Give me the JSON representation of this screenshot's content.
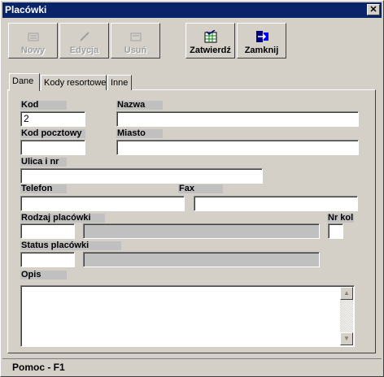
{
  "window": {
    "title": "Placówki",
    "close_glyph": "✕"
  },
  "toolbar": {
    "new_label": "Nowy",
    "edit_label": "Edycja",
    "delete_label": "Usuń",
    "confirm_label": "Zatwierdź",
    "close_label": "Zamknij"
  },
  "tabs": [
    {
      "label": "Dane"
    },
    {
      "label": "Kody resortowe"
    },
    {
      "label": "Inne"
    }
  ],
  "form": {
    "kod": {
      "label": "Kod",
      "value": "2"
    },
    "nazwa": {
      "label": "Nazwa",
      "value": ""
    },
    "kod_pocztowy": {
      "label": "Kod pocztowy",
      "value": ""
    },
    "miasto": {
      "label": "Miasto",
      "value": ""
    },
    "ulica": {
      "label": "Ulica i nr",
      "value": ""
    },
    "telefon": {
      "label": "Telefon",
      "value": ""
    },
    "fax": {
      "label": "Fax",
      "value": ""
    },
    "rodzaj": {
      "label": "Rodzaj placówki",
      "code": "",
      "name": ""
    },
    "nr_kol": {
      "label": "Nr kol",
      "value": ""
    },
    "status": {
      "label": "Status placówki",
      "code": "",
      "name": ""
    },
    "opis": {
      "label": "Opis",
      "value": ""
    }
  },
  "statusbar": {
    "text": "Pomoc - F1"
  }
}
